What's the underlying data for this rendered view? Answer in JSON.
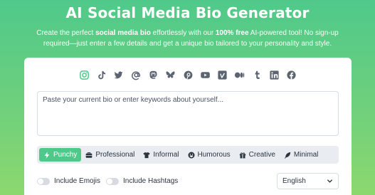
{
  "header": {
    "title": "AI Social Media Bio Generator",
    "subtitle_part1": "Create the perfect ",
    "subtitle_bold1": "social media bio",
    "subtitle_part2": " effortlessly with our ",
    "subtitle_bold2": "100% free",
    "subtitle_part3": " AI-powered tool! No sign-up required—just enter a few details and get a unique bio tailored to your personality and style."
  },
  "platforms": [
    {
      "name": "instagram-icon",
      "color": "#4fc98a"
    },
    {
      "name": "tiktok-icon",
      "color": "#5b6470"
    },
    {
      "name": "twitter-icon",
      "color": "#5b6470"
    },
    {
      "name": "at-sign-icon",
      "color": "#5b6470"
    },
    {
      "name": "mastodon-icon",
      "color": "#5b6470"
    },
    {
      "name": "bluesky-icon",
      "color": "#5b6470"
    },
    {
      "name": "pinterest-icon",
      "color": "#5b6470"
    },
    {
      "name": "youtube-icon",
      "color": "#5b6470"
    },
    {
      "name": "vimeo-icon",
      "color": "#5b6470"
    },
    {
      "name": "medium-icon",
      "color": "#5b6470"
    },
    {
      "name": "tumblr-icon",
      "color": "#5b6470"
    },
    {
      "name": "linkedin-icon",
      "color": "#5b6470"
    },
    {
      "name": "facebook-icon",
      "color": "#5b6470"
    }
  ],
  "input": {
    "placeholder": "Paste your current bio or enter keywords about yourself..."
  },
  "styles": [
    {
      "label": "Punchy",
      "icon": "bolt-icon",
      "active": true
    },
    {
      "label": "Professional",
      "icon": "briefcase-icon",
      "active": false
    },
    {
      "label": "Informal",
      "icon": "tshirt-icon",
      "active": false
    },
    {
      "label": "Humorous",
      "icon": "laugh-icon",
      "active": false
    },
    {
      "label": "Creative",
      "icon": "gift-icon",
      "active": false
    },
    {
      "label": "Minimal",
      "icon": "feather-icon",
      "active": false
    }
  ],
  "options": {
    "emojis_label": "Include Emojis",
    "hashtags_label": "Include Hashtags",
    "language": "English"
  },
  "colors": {
    "accent": "#4fc98a",
    "icon_gray": "#5b6470"
  }
}
